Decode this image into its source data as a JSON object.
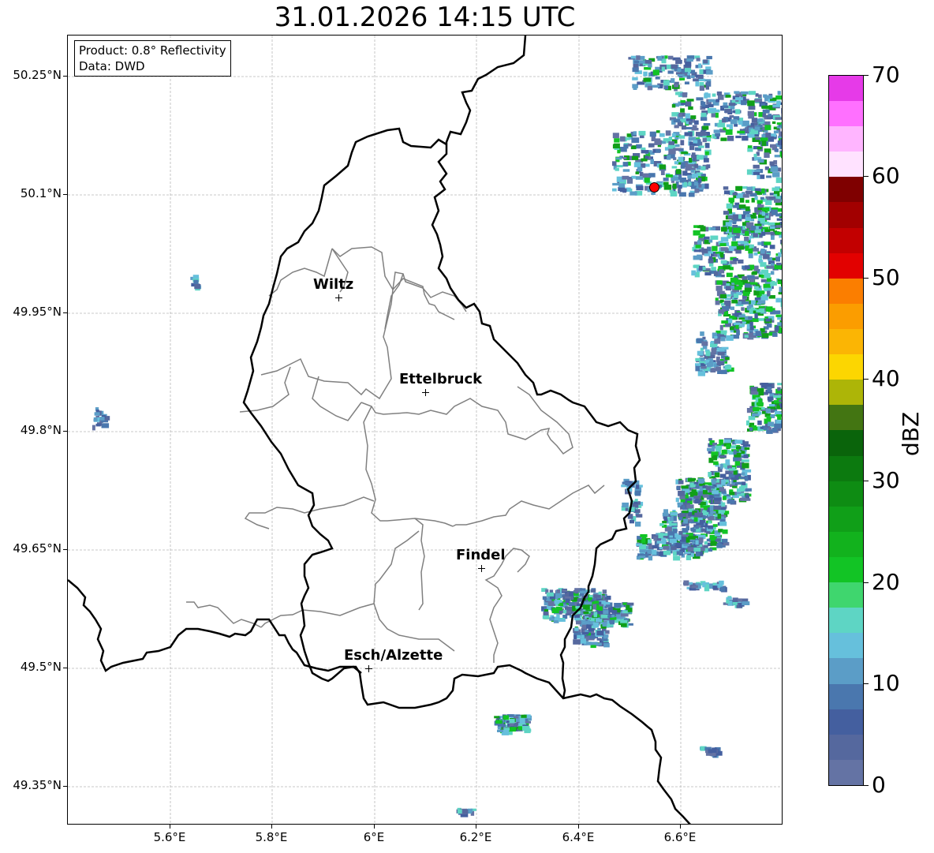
{
  "title": "31.01.2026 14:15 UTC",
  "info": {
    "product": "Product: 0.8° Reflectivity",
    "data": "Data: DWD"
  },
  "axes": {
    "lat_labels": [
      "50.25°N",
      "50.1°N",
      "49.95°N",
      "49.8°N",
      "49.65°N",
      "49.5°N",
      "49.35°N"
    ],
    "lon_labels": [
      "5.6°E",
      "5.8°E",
      "6°E",
      "6.2°E",
      "6.4°E",
      "6.6°E"
    ]
  },
  "cities": [
    {
      "name": "Wiltz"
    },
    {
      "name": "Ettelbruck"
    },
    {
      "name": "Findel"
    },
    {
      "name": "Esch/Alzette"
    }
  ],
  "colorbar": {
    "title": "dBZ",
    "tick_labels": [
      "0",
      "10",
      "20",
      "30",
      "40",
      "50",
      "60",
      "70"
    ],
    "colors": [
      "#6473a4",
      "#55689e",
      "#445f9f",
      "#4a77ae",
      "#5b9dc7",
      "#66c0dc",
      "#5ed5c4",
      "#3fd66e",
      "#12c425",
      "#12b21d",
      "#109f18",
      "#0e8c13",
      "#0c7a0f",
      "#0a640b",
      "#437512",
      "#adb507",
      "#fcd601",
      "#fbb504",
      "#fb9d00",
      "#fb7e00",
      "#e20100",
      "#c20000",
      "#a20000",
      "#7f0000",
      "#ffe2ff",
      "#ffb5ff",
      "#ff70ff",
      "#e63ae8"
    ]
  }
}
